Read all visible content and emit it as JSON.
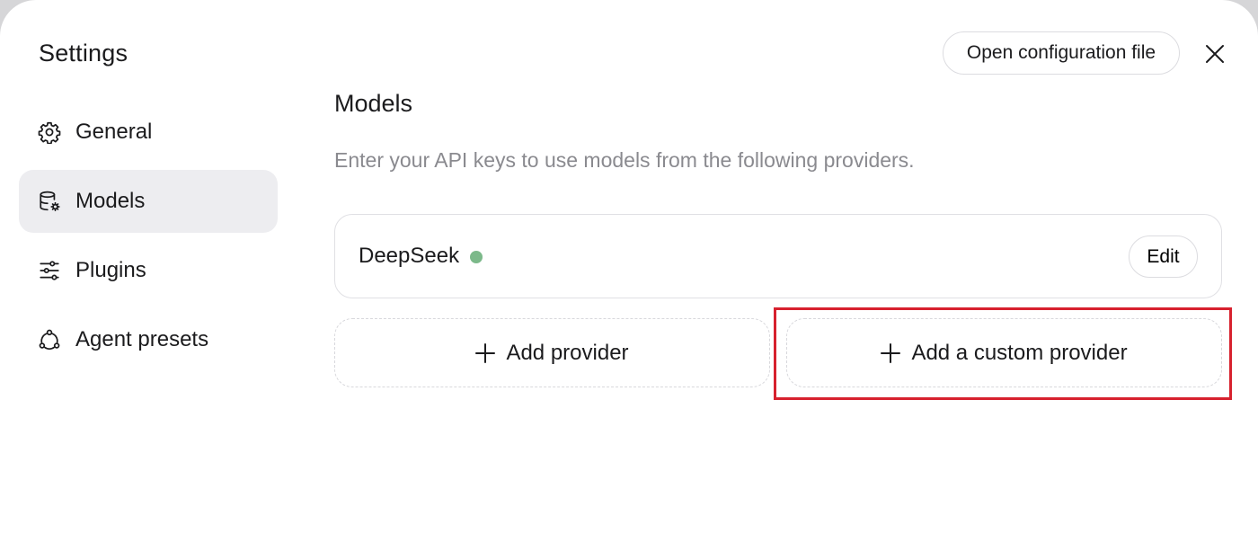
{
  "sidebar": {
    "title": "Settings",
    "items": [
      {
        "label": "General",
        "icon": "gear-icon",
        "active": false
      },
      {
        "label": "Models",
        "icon": "database-settings-icon",
        "active": true
      },
      {
        "label": "Plugins",
        "icon": "sliders-icon",
        "active": false
      },
      {
        "label": "Agent presets",
        "icon": "agent-cycle-icon",
        "active": false
      }
    ]
  },
  "header": {
    "open_config_label": "Open configuration file",
    "close_icon": "close-icon"
  },
  "main": {
    "title": "Models",
    "description": "Enter your API keys to use models from the following providers.",
    "providers": [
      {
        "name": "DeepSeek",
        "status_color": "#7cb98a",
        "edit_label": "Edit"
      }
    ],
    "add_provider_label": "Add provider",
    "add_custom_provider_label": "Add a custom provider"
  },
  "colors": {
    "highlight": "#d7212e",
    "active_nav_bg": "#ededf0"
  }
}
